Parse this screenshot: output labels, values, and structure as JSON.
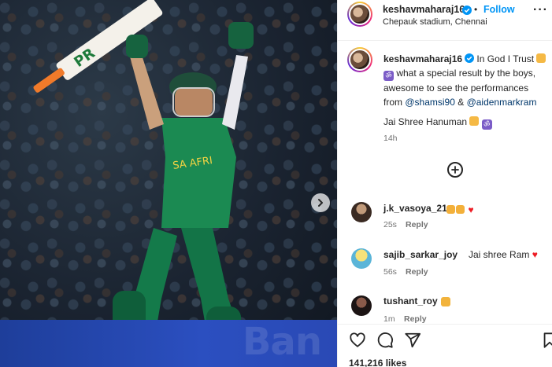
{
  "post": {
    "image_alt_visible": "",
    "board_text": "Ban"
  },
  "header": {
    "username": "keshavmaharaj16",
    "separator": "•",
    "follow_label": "Follow",
    "location": "Chepauk stadium, Chennai",
    "more_label": "···"
  },
  "caption": {
    "username": "keshavmaharaj16",
    "text_1": " In God I Trust ",
    "text_2": " what a special result by the boys, awesome to see the performances from ",
    "mention_1": "@shamsi90",
    "amp": " & ",
    "mention_2": "@aidenmarkram",
    "jai_line": "Jai Shree Hanuman ",
    "time": "14h"
  },
  "comments": [
    {
      "user": "j.k_vasoya_21",
      "text": "",
      "age": "25s",
      "reply": "Reply"
    },
    {
      "user": "sajib_sarkar_joy",
      "text": "Jai shree Ram",
      "age": "56s",
      "reply": "Reply"
    },
    {
      "user": "tushant_roy",
      "text": "",
      "age": "1m",
      "reply": "Reply"
    }
  ],
  "actions": {
    "like_icon": "heart-outline-icon",
    "comment_icon": "comment-icon",
    "share_icon": "send-icon",
    "save_icon": "bookmark-icon"
  },
  "likes": "141,216 likes",
  "colors": {
    "accent": "#0095f6",
    "text": "#262626",
    "muted": "#737373",
    "mention": "#00376b",
    "heart": "#ed1c24"
  }
}
